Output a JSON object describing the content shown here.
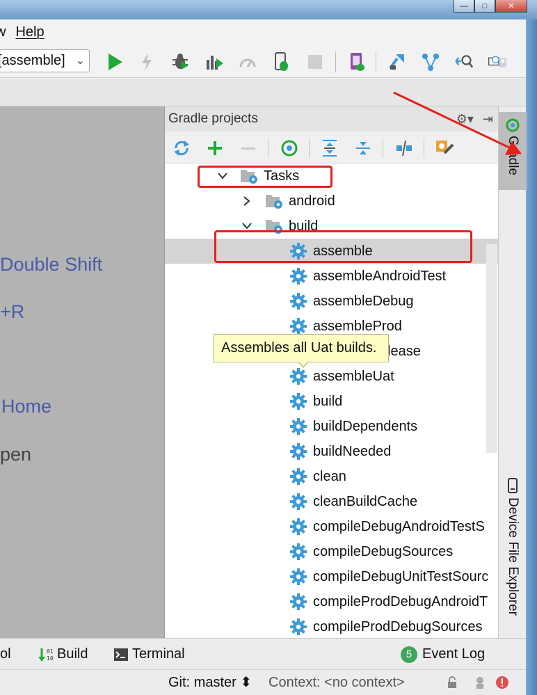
{
  "menu": {
    "partial_item": "w",
    "help": "Help"
  },
  "toolbar": {
    "run_config": "[assemble]",
    "icons": [
      "run-icon",
      "apply-changes-icon",
      "debug-icon",
      "profile-icon",
      "attach-debugger-icon",
      "debug-android-icon",
      "stop-icon",
      "avd-manager-icon",
      "sdk-manager-icon",
      "sync-icon",
      "search-icon",
      "device-icon"
    ]
  },
  "editor_hints": {
    "search_everywhere": "Double Shift",
    "recent_files_shortcut": "+R",
    "navigation_bar": "Home",
    "drop_files": "pen"
  },
  "gradle_panel": {
    "title": "Gradle projects",
    "tree": [
      {
        "label": "Tasks",
        "expanded": true
      },
      {
        "label": "android",
        "expanded": false
      },
      {
        "label": "build",
        "expanded": true
      },
      {
        "label": "assemble",
        "selected": true
      },
      {
        "label": "assembleAndroidTest"
      },
      {
        "label": "assembleDebug"
      },
      {
        "label": "assembleProd"
      },
      {
        "label": "assembleRelease",
        "visible_text": "lease"
      },
      {
        "label": "assembleUat"
      },
      {
        "label": "build"
      },
      {
        "label": "buildDependents"
      },
      {
        "label": "buildNeeded"
      },
      {
        "label": "clean"
      },
      {
        "label": "cleanBuildCache"
      },
      {
        "label": "compileDebugAndroidTestS"
      },
      {
        "label": "compileDebugSources"
      },
      {
        "label": "compileDebugUnitTestSourc"
      },
      {
        "label": "compileProdDebugAndroidT"
      },
      {
        "label": "compileProdDebugSources"
      }
    ],
    "tooltip": "Assembles all Uat builds."
  },
  "right_strip": {
    "gradle_tab": "Gradle",
    "device_file_explorer_tab": "Device File Explorer"
  },
  "bottom_bar": {
    "partial_tool": "ol",
    "build": "Build",
    "terminal": "Terminal",
    "event_log": "Event Log",
    "event_count": "5"
  },
  "status_bar": {
    "git": "Git: master ⬍",
    "context": "Context: <no context>"
  },
  "colors": {
    "highlight_red": "#e4211b",
    "tooltip_bg": "#fdfdc4",
    "hint_blue": "#4a5aa8",
    "gear_blue": "#3c9ad8",
    "run_green": "#21a83a"
  }
}
